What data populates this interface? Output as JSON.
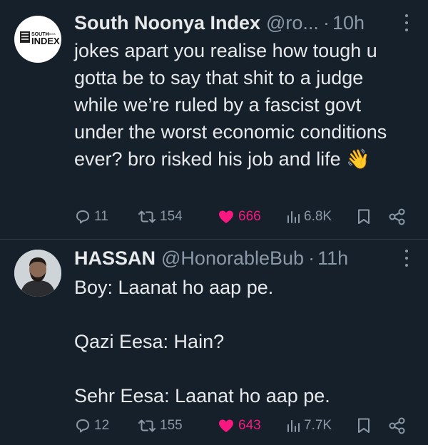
{
  "tweets": [
    {
      "avatar": {
        "logo_top_text": "SOUTH",
        "logo_small_text": "NOONYA",
        "logo_main_text": "INDEX"
      },
      "name": "South Noonya Index",
      "handle": "@ro...",
      "dot": "·",
      "time": "10h",
      "text": "jokes apart you realise how tough u gotta be to say that shit to a judge while we’re ruled by a fascist govt under the worst economic conditions ever? bro risked his job and life 👋",
      "replies": "11",
      "retweets": "154",
      "likes": "666",
      "views": "6.8K",
      "liked": true
    },
    {
      "avatar": {},
      "name": "HASSAN",
      "handle": "@HonorableBub",
      "dot": "·",
      "time": "11h",
      "text": "Boy: Laanat ho aap pe.\n\nQazi Eesa: Hain?\n\nSehr Eesa: Laanat ho aap pe.",
      "replies": "12",
      "retweets": "155",
      "likes": "643",
      "views": "7.7K",
      "liked": true
    }
  ],
  "colors": {
    "background": "#15202b",
    "text": "#e7e9ea",
    "muted": "#8b98a5",
    "like": "#f91880",
    "divider": "#2f3b47"
  },
  "icons": [
    "more-icon",
    "reply-icon",
    "retweet-icon",
    "heart-icon",
    "views-icon",
    "bookmark-icon",
    "share-icon"
  ]
}
